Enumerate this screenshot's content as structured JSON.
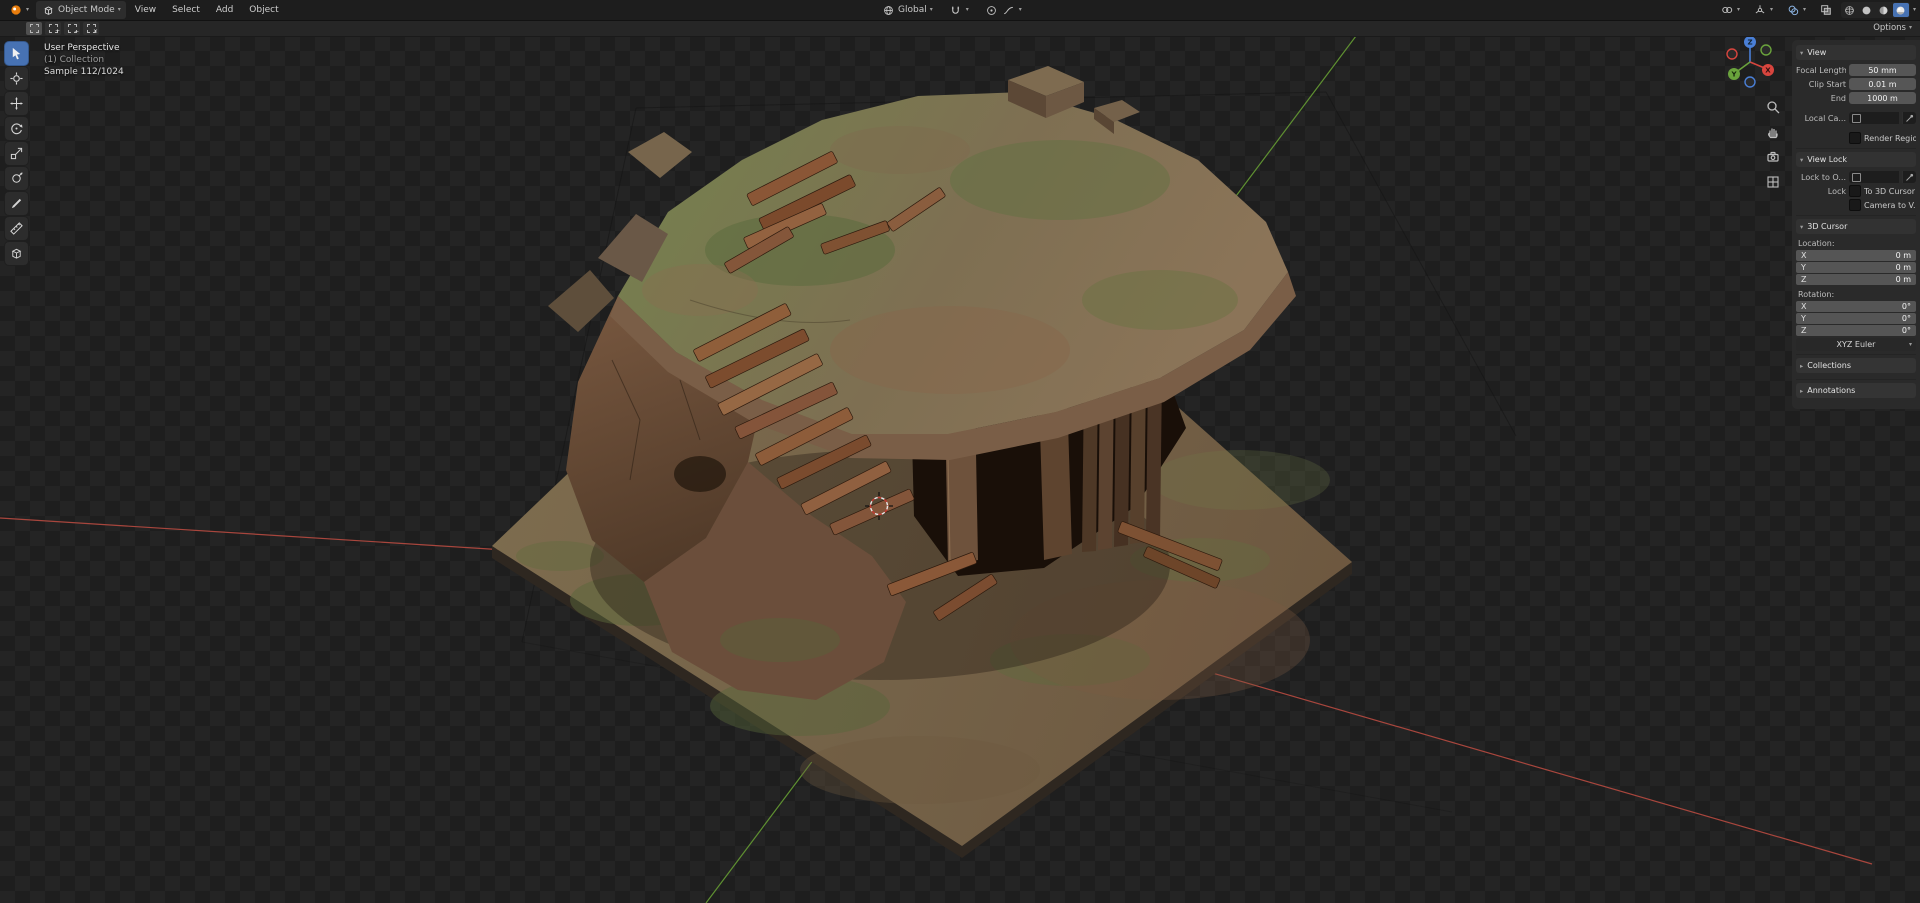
{
  "header": {
    "editor_icon": "editor-type-3d-viewport-icon",
    "mode": {
      "label": "Object Mode",
      "icon": "object-mode-cube-icon"
    },
    "menus": [
      "View",
      "Select",
      "Add",
      "Object"
    ],
    "transform_orientation": {
      "label": "Global",
      "icon": "orientation-global-icon"
    },
    "snap_icon": "snap-magnet-icon",
    "proportional_icons": [
      "proportional-editing-icon",
      "proportional-falloff-icon"
    ],
    "right_icons": [
      "object-visibility-icon",
      "show-gizmos-icon",
      "show-overlays-icon",
      "toggle-xray-icon"
    ],
    "shading_modes": [
      "wireframe",
      "solid",
      "material-preview",
      "rendered"
    ],
    "active_shading": "rendered"
  },
  "tool_settings": {
    "select_modes": [
      "set",
      "extend",
      "subtract",
      "intersect"
    ],
    "options_label": "Options"
  },
  "toolbar": {
    "active_tool": "tweak-select",
    "tools": [
      "tweak-select",
      "cursor",
      "move",
      "rotate",
      "scale",
      "transform",
      "annotate",
      "measure",
      "add-cube"
    ]
  },
  "viewport": {
    "info_line1": "User Perspective",
    "info_line2": "(1) Collection",
    "info_line3": "Sample 112/1024",
    "nav_controls": [
      "zoom",
      "pan",
      "toggle-camera-view",
      "toggle-orthographic"
    ],
    "gizmo_axes": [
      "X",
      "Y",
      "Z"
    ]
  },
  "sidebar": {
    "view": {
      "title": "View",
      "focal": {
        "label": "Focal Length",
        "value": "50 mm"
      },
      "clip_start": {
        "label": "Clip Start",
        "value": "0.01 m"
      },
      "clip_end": {
        "label": "End",
        "value": "1000 m"
      },
      "local_camera": {
        "label": "Local Ca..."
      },
      "render_region": {
        "label": "Render Region"
      }
    },
    "view_lock": {
      "title": "View Lock",
      "lock_to_object": {
        "label": "Lock to O..."
      },
      "lock_label": "Lock",
      "to_3d_cursor": "To 3D Cursor",
      "camera_to_view": "Camera to V..."
    },
    "cursor3d": {
      "title": "3D Cursor",
      "location_label": "Location:",
      "location": [
        {
          "axis": "X",
          "value": "0 m"
        },
        {
          "axis": "Y",
          "value": "0 m"
        },
        {
          "axis": "Z",
          "value": "0 m"
        }
      ],
      "rotation_label": "Rotation:",
      "rotation": [
        {
          "axis": "X",
          "value": "0°"
        },
        {
          "axis": "Y",
          "value": "0°"
        },
        {
          "axis": "Z",
          "value": "0°"
        }
      ],
      "rotation_mode": "XYZ Euler"
    },
    "collections": {
      "title": "Collections"
    },
    "annotations": {
      "title": "Annotations"
    }
  },
  "colors": {
    "accent_blue": "#4772b3",
    "axis_x_red": "#a8463d",
    "axis_y_green": "#5f9131",
    "axis_z_blue": "#4a7fd6",
    "header_bg": "#1d1d1d",
    "panel_bg": "#2a2a2a",
    "field_gray": "#565656",
    "checker_dark": "#1e1e1e",
    "checker_light": "#242424"
  }
}
